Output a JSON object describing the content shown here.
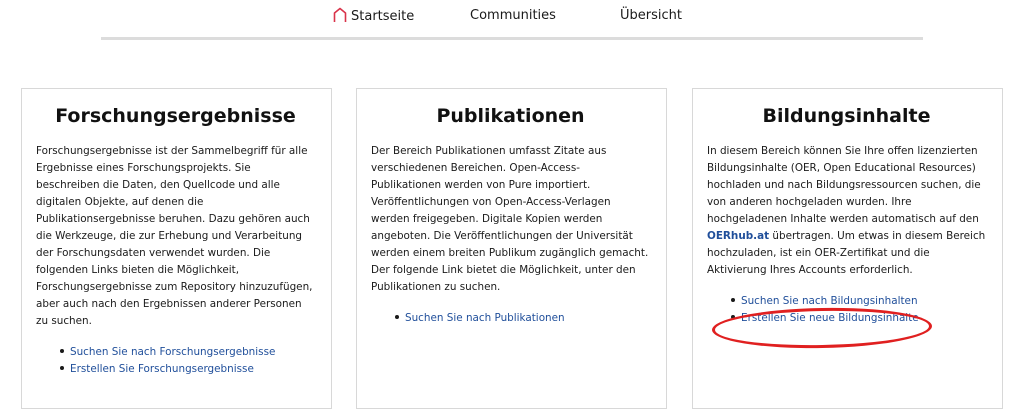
{
  "nav": {
    "home_label": "Startseite",
    "communities_label": "Communities",
    "overview_label": "Übersicht",
    "home_icon": "house-outline-icon",
    "accent": "#d9334a"
  },
  "cards": [
    {
      "title": "Forschungsergebnisse",
      "body": "Forschungsergebnisse ist der Sammelbegriff für alle Ergebnisse eines Forschungsprojekts. Sie beschreiben die Daten, den Quellcode und alle digitalen Objekte, auf denen die Publikationsergebnisse beruhen. Dazu gehören auch die Werkzeuge, die zur Erhebung und Verarbeitung der Forschungsdaten verwendet wurden. Die folgenden Links bieten die Möglichkeit, Forschungsergebnisse zum Repository hinzuzufügen, aber auch nach den Ergebnissen anderer Personen zu suchen.",
      "links": [
        "Suchen Sie nach Forschungsergebnisse",
        "Erstellen Sie Forschungsergebnisse"
      ]
    },
    {
      "title": "Publikationen",
      "body": "Der Bereich Publikationen umfasst Zitate aus verschiedenen Bereichen. Open-Access-Publikationen werden von Pure importiert. Veröffentlichungen von Open-Access-Verlagen werden freigegeben. Digitale Kopien werden angeboten. Die Veröffentlichungen der Universität werden einem breiten Publikum zugänglich gemacht. Der folgende Link bietet die Möglichkeit, unter den Publikationen zu suchen.",
      "links": [
        "Suchen Sie nach Publikationen"
      ]
    },
    {
      "title": "Bildungsinhalte",
      "body_part1": "In diesem Bereich können Sie Ihre offen lizenzierten Bildungsinhalte (OER, Open Educational Resources) hochladen und nach Bildungsressourcen suchen, die von anderen hochgeladen wurden. Ihre hochgeladenen Inhalte werden automatisch auf den ",
      "body_link": "OERhub.at",
      "body_part2": " übertragen. Um etwas in diesem Bereich hochzuladen, ist ein OER-Zertifikat und die Aktivierung Ihres Accounts erforderlich.",
      "links": [
        "Suchen Sie nach Bildungsinhalten",
        "Erstellen Sie neue Bildungsinhalte"
      ]
    }
  ],
  "colors": {
    "link": "#1f4e9a",
    "annotation": "#e02020",
    "divider": "#dcdcdc"
  }
}
